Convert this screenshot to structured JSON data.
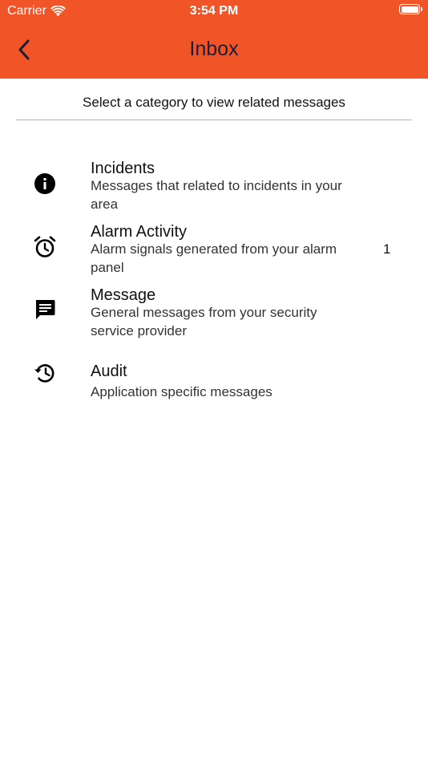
{
  "status_bar": {
    "carrier": "Carrier",
    "time": "3:54 PM"
  },
  "header": {
    "title": "Inbox",
    "back_icon": "chevron-left-icon",
    "background_color": "#F15427"
  },
  "subtitle": "Select a category to view related messages",
  "categories": [
    {
      "icon": "info-icon",
      "title": "Incidents",
      "description": "Messages that related to incidents in your area",
      "count": ""
    },
    {
      "icon": "alarm-clock-icon",
      "title": "Alarm Activity",
      "description": "Alarm signals generated from your alarm panel",
      "count": "1"
    },
    {
      "icon": "message-icon",
      "title": "Message",
      "description": "General messages from your security service provider",
      "count": ""
    },
    {
      "icon": "history-icon",
      "title": "Audit",
      "description": "Application specific messages",
      "count": ""
    }
  ]
}
